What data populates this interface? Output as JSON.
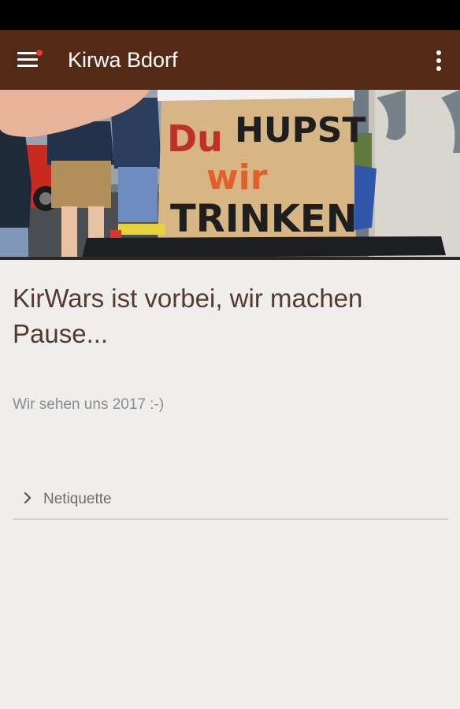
{
  "app_bar": {
    "title": "Kirwa Bdorf",
    "menu_icon": "hamburger-menu-icon",
    "overflow_icon": "more-vert-icon",
    "bar_color": "#542a17",
    "notification_dot_color": "#e53935"
  },
  "hero_image": {
    "sign_text_line1_a": "Du",
    "sign_text_line1_b": "HUPST",
    "sign_text_line2": "wir",
    "sign_text_line3": "TRINKEN"
  },
  "content": {
    "headline": "KirWars ist vorbei, wir machen Pause...",
    "subtext": "Wir sehen uns 2017 :-)"
  },
  "links": [
    {
      "label": "Netiquette",
      "icon": "chevron-right-icon"
    }
  ]
}
